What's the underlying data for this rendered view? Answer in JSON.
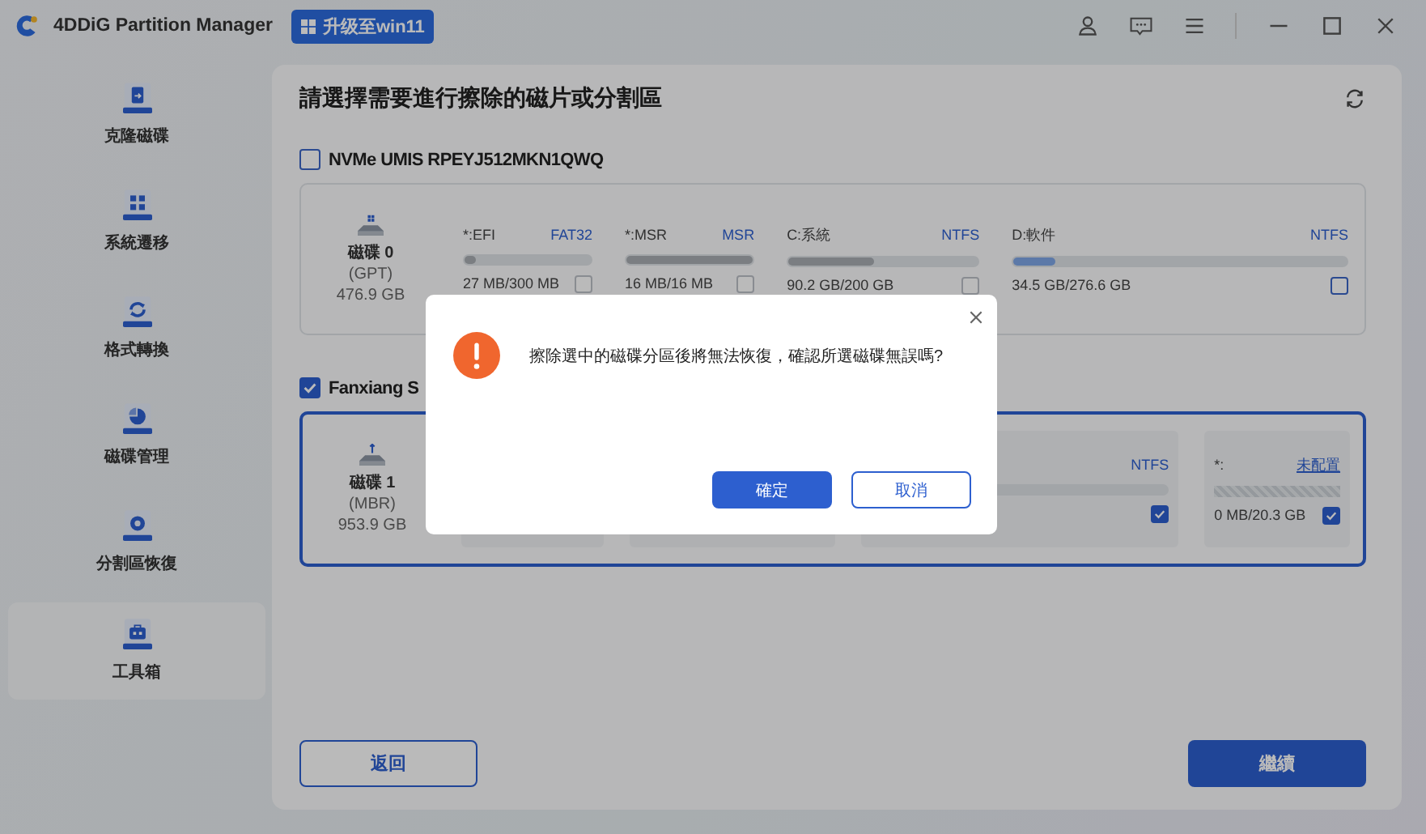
{
  "window": {
    "title": "4DDiG Partition Manager",
    "upgrade_button": "升级至win11"
  },
  "sidebar": {
    "items": [
      {
        "label": "克隆磁碟",
        "selected": false
      },
      {
        "label": "系統遷移",
        "selected": false
      },
      {
        "label": "格式轉換",
        "selected": false
      },
      {
        "label": "磁碟管理",
        "selected": false
      },
      {
        "label": "分割區恢復",
        "selected": false
      },
      {
        "label": "工具箱",
        "selected": true
      }
    ]
  },
  "main": {
    "title": "請選擇需要進行擦除的磁片或分割區",
    "disks": [
      {
        "name": "NVMe UMIS RPEYJ512MKN1QWQ",
        "checked": false,
        "label": "磁碟 0",
        "style": "(GPT)",
        "size": "476.9 GB",
        "partitions": [
          {
            "kind": "partition",
            "name": "*:EFI",
            "fs": "FAT32",
            "level": 0.09,
            "usage": "27 MB/300 MB",
            "checked": false,
            "disabled": true
          },
          {
            "kind": "partition",
            "name": "*:MSR",
            "fs": "MSR",
            "level": 1,
            "usage": "16 MB/16 MB",
            "checked": false,
            "disabled": true
          },
          {
            "kind": "partition",
            "name": "C:系統",
            "fs": "NTFS",
            "level": 0.45,
            "usage": "90.2 GB/200 GB",
            "checked": false,
            "disabled": true
          },
          {
            "kind": "partition",
            "name": "D:軟件",
            "fs": "NTFS",
            "level": 0.125,
            "usage": "34.5 GB/276.6 GB",
            "checked": false,
            "disabled": false
          }
        ]
      },
      {
        "name": "Fanxiang S",
        "checked": true,
        "label": "磁碟 1",
        "style": "(MBR)",
        "size": "953.9 GB",
        "partitions": [
          {
            "kind": "partition"
          },
          {
            "kind": "partition"
          },
          {
            "kind": "partition",
            "fs": "NTFS",
            "checked": true,
            "disabled": false
          },
          {
            "kind": "unallocated",
            "name": "*:",
            "fs": "未配置",
            "usage": "0 MB/20.3 GB",
            "checked": true,
            "disabled": false
          }
        ]
      }
    ],
    "back_button": "返回",
    "continue_button": "繼續"
  },
  "dialog": {
    "message": "擦除選中的磁碟分區後將無法恢復，確認所選磁碟無誤嗎?",
    "ok_button": "確定",
    "cancel_button": "取消"
  }
}
